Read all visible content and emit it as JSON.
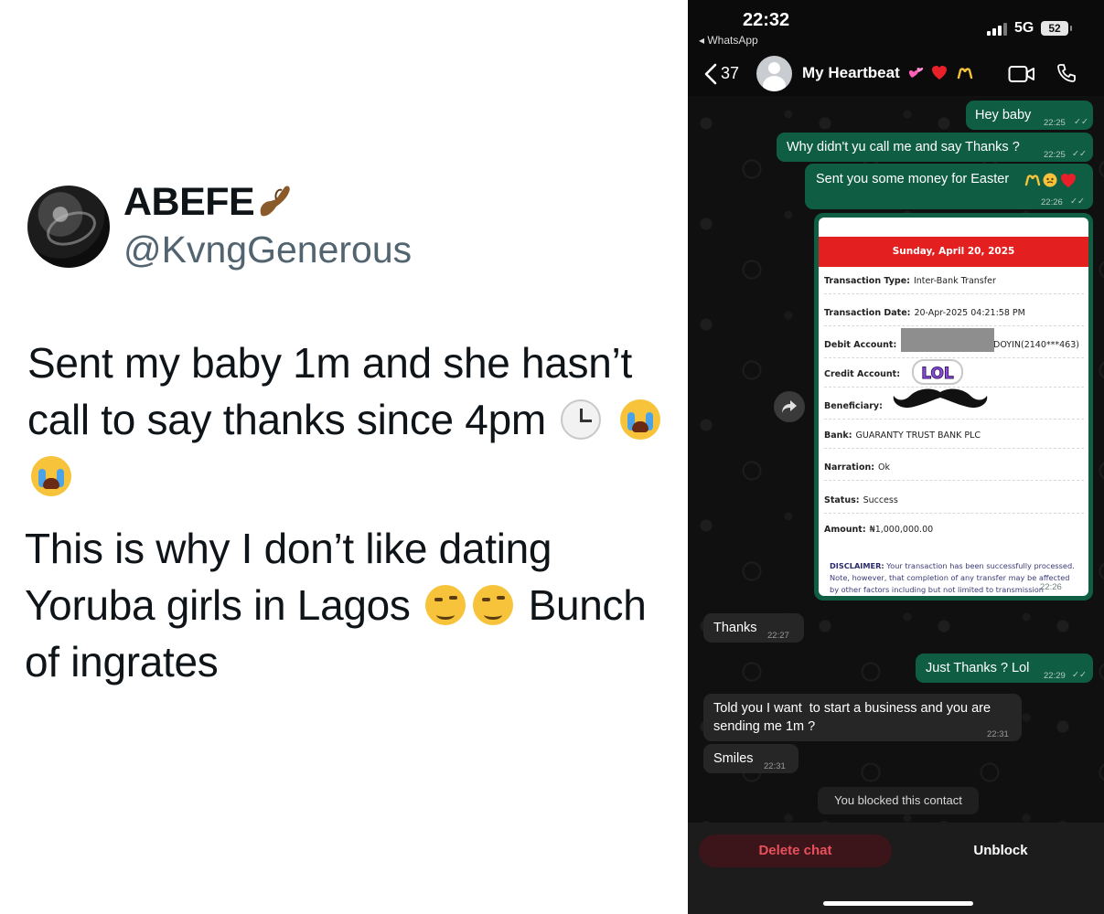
{
  "tweet": {
    "display_name": "ABEFE",
    "handle": "@KvngGenerous",
    "paragraph1": {
      "line1": "Sent my baby 1m and she hasn’t",
      "line2": "call to say thanks since 4pm"
    },
    "paragraph2": {
      "line1": "This is why I don’t like dating",
      "line2a": "Yoruba girls in Lagos",
      "line2b": "Bunch",
      "line3": "of ingrates"
    },
    "icons": [
      "pinched-fingers-icon",
      "clock-icon",
      "crying-face-icon",
      "winking-face-icon"
    ]
  },
  "phone": {
    "status": {
      "time": "22:32",
      "back_app": "◂ WhatsApp",
      "network": "5G",
      "battery": "52"
    },
    "header": {
      "back_count": "37",
      "contact_name": "My Heartbeat",
      "icons": [
        "two-hearts-icon",
        "red-heart-icon",
        "heart-hands-icon",
        "video-call-icon",
        "phone-call-icon"
      ]
    },
    "messages": [
      {
        "dir": "out",
        "text": "Hey baby",
        "time": "22:25"
      },
      {
        "dir": "out",
        "text": "Why didn't yu call me and say Thanks ?",
        "time": "22:25"
      },
      {
        "dir": "out",
        "text": "Sent you some money for Easter",
        "time": "22:26"
      },
      {
        "dir": "in",
        "text": "Thanks",
        "time": "22:27"
      },
      {
        "dir": "out",
        "text": "Just Thanks ? Lol",
        "time": "22:29"
      },
      {
        "dir": "in",
        "text_line1": "Told you I want  to start a business and you are",
        "text_line2": "sending me 1m ?",
        "time": "22:31"
      },
      {
        "dir": "in",
        "text": "Smiles",
        "time": "22:31"
      }
    ],
    "receipt": {
      "date_header": "Sunday, April 20, 2025",
      "rows": [
        {
          "label": "Transaction Type:",
          "value": "Inter-Bank Transfer"
        },
        {
          "label": "Transaction Date:",
          "value": "20-Apr-2025 04:21:58 PM"
        },
        {
          "label": "Debit Account:",
          "value": "DOYIN(2140***463)"
        },
        {
          "label": "Credit Account:",
          "value": ""
        },
        {
          "label": "Beneficiary:",
          "value": ""
        },
        {
          "label": "Bank:",
          "value": "GUARANTY TRUST BANK PLC"
        },
        {
          "label": "Narration:",
          "value": "Ok"
        },
        {
          "label": "Status:",
          "value": "Success"
        },
        {
          "label": "Amount:",
          "value": "₦1,000,000.00"
        }
      ],
      "disclaimer_label": "DISCLAIMER:",
      "disclaimer_text": "Your transaction has been successfully processed. Note, however, that completion of any transfer may be affected by other factors including but not limited to transmission",
      "sticker_text": "LOL",
      "time": "22:26"
    },
    "system_message": "You blocked this contact",
    "actions": {
      "delete_label": "Delete chat",
      "unblock_label": "Unblock"
    },
    "colors": {
      "outgoing_bubble": "#0f5e44",
      "incoming_bubble": "#262626",
      "receipt_header": "#e41f1f",
      "delete_text": "#e8505b"
    }
  }
}
